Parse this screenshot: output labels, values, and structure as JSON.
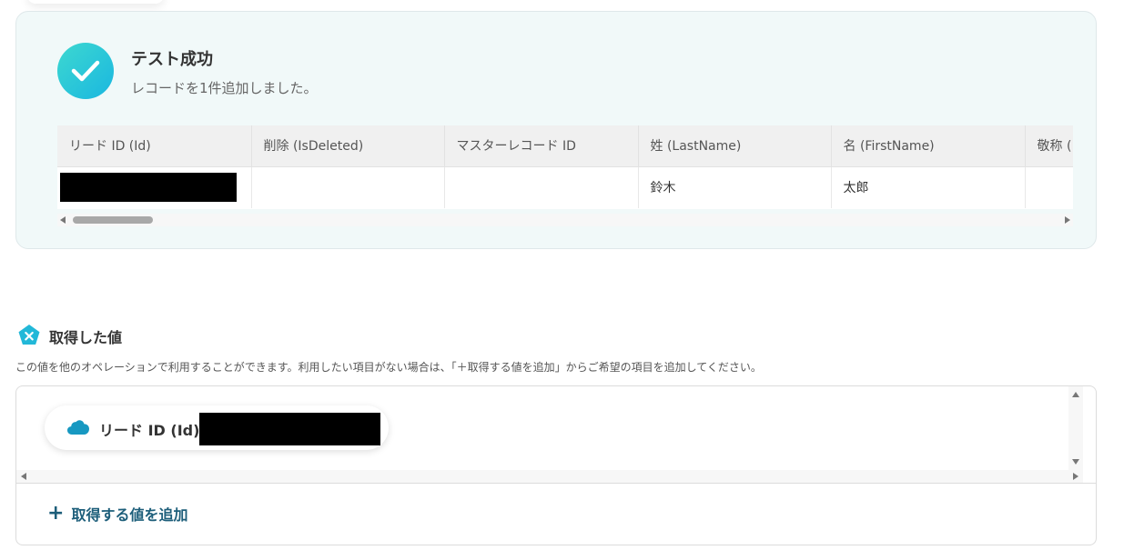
{
  "result": {
    "title": "テスト成功",
    "subtitle": "レコードを1件追加しました。",
    "columns": [
      "リード ID (Id)",
      "削除 (IsDeleted)",
      "マスターレコード ID",
      "姓 (LastName)",
      "名 (FirstName)",
      "敬称 ("
    ],
    "row": {
      "id": "",
      "is_deleted": "",
      "master_record_id": "",
      "last_name": "鈴木",
      "first_name": "太郎",
      "salutation": ""
    }
  },
  "retrieved": {
    "title": "取得した値",
    "description": "この値を他のオペレーションで利用することができます。利用したい項目がない場合は、「＋取得する値を追加」からご希望の項目を追加してください。",
    "chip_label": "リード ID (Id)",
    "add_label": "取得する値を追加",
    "add_icon": "+"
  },
  "colors": {
    "accent": "#1d5e7a",
    "success_start": "#3dd8d0",
    "success_end": "#1ab7e0",
    "card_bg": "#f1f9f9",
    "salesforce_blue": "#1798c1"
  },
  "icons": {
    "success": "check-icon",
    "section": "yoom-x-icon",
    "chip": "salesforce-cloud-icon"
  }
}
